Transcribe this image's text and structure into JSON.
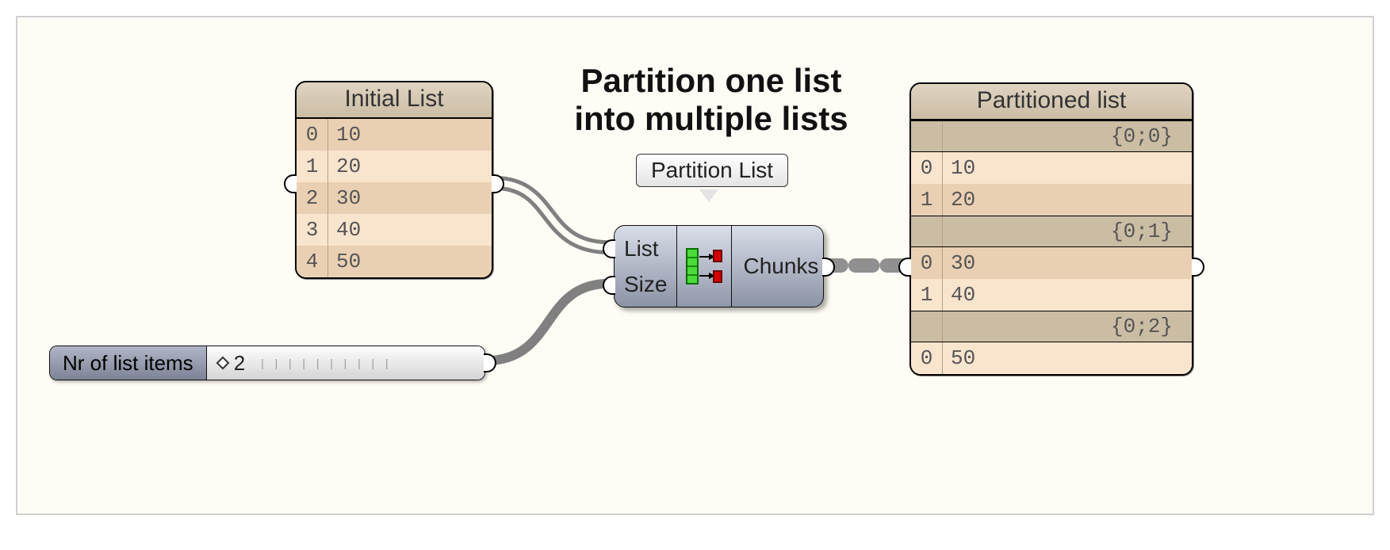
{
  "diagram": {
    "title_line1": "Partition one list",
    "title_line2": "into multiple lists"
  },
  "tooltip": {
    "label": "Partition List"
  },
  "initial_panel": {
    "title": "Initial List",
    "rows": [
      {
        "index": "0",
        "value": "10"
      },
      {
        "index": "1",
        "value": "20"
      },
      {
        "index": "2",
        "value": "30"
      },
      {
        "index": "3",
        "value": "40"
      },
      {
        "index": "4",
        "value": "50"
      }
    ]
  },
  "slider": {
    "label": "Nr of list items",
    "value": "2"
  },
  "component": {
    "inputs": {
      "list": "List",
      "size": "Size"
    },
    "output": "Chunks",
    "icon_name": "partition-list-icon"
  },
  "partitioned_panel": {
    "title": "Partitioned list",
    "branches": [
      {
        "path": "{0;0}",
        "items": [
          {
            "index": "0",
            "value": "10"
          },
          {
            "index": "1",
            "value": "20"
          }
        ]
      },
      {
        "path": "{0;1}",
        "items": [
          {
            "index": "0",
            "value": "30"
          },
          {
            "index": "1",
            "value": "40"
          }
        ]
      },
      {
        "path": "{0;2}",
        "items": [
          {
            "index": "0",
            "value": "50"
          }
        ]
      }
    ]
  },
  "wires": {
    "initial_to_list": "double",
    "slider_to_size": "single",
    "chunks_to_partitioned": "dashed"
  }
}
